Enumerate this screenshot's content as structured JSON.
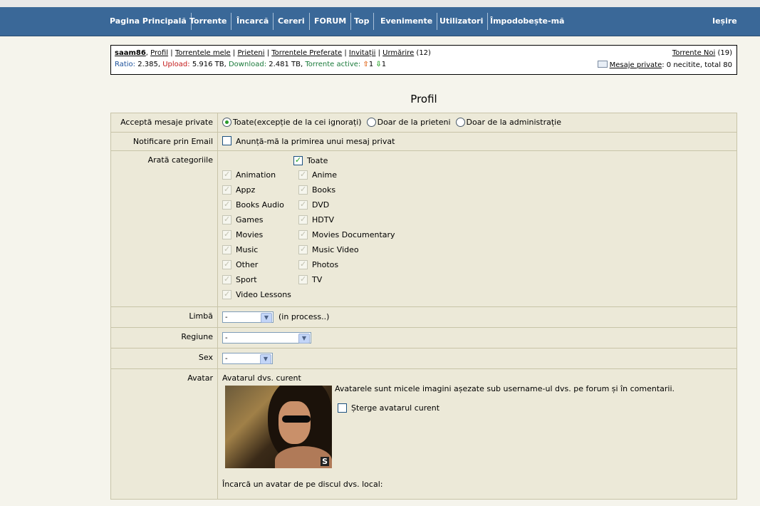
{
  "nav": {
    "items": [
      "Pagina Principală",
      "Torrente",
      "Încarcă",
      "Cereri",
      "FORUM",
      "Top",
      "Evenimente",
      "Utilizatori",
      "Împodobește-mă"
    ],
    "logout": "Ieșire"
  },
  "userbox": {
    "username": "saam86",
    "links": [
      "Profil",
      "Torrentele mele",
      "Prieteni",
      "Torrentele Preferate",
      "Invitații",
      "Urmărire"
    ],
    "follow_count": "(12)",
    "ratio_label": "Ratio:",
    "ratio_value": "2.385",
    "upload_label": "Upload:",
    "upload_value": "5.916 TB",
    "download_label": "Download:",
    "download_value": "2.481 TB",
    "active_label": "Torrente active:",
    "active_up": "1",
    "active_down": "1",
    "new_torrents_label": "Torrente Noi",
    "new_torrents_count": "(19)",
    "pm_label": "Mesaje private",
    "pm_status": ": 0 necitite, total 80"
  },
  "page_title": "Profil",
  "form": {
    "pm_label": "Acceptă mesaje private",
    "pm_options": [
      "Toate(excepție de la cei ignorați)",
      "Doar de la prieteni",
      "Doar de la administrație"
    ],
    "email_label": "Notificare prin Email",
    "email_option": "Anunță-mă la primirea unui mesaj privat",
    "categories_label": "Arată categoriile",
    "categories_all": "Toate",
    "categories": [
      "Animation",
      "Anime",
      "Appz",
      "Books",
      "Books Audio",
      "DVD",
      "Games",
      "HDTV",
      "Movies",
      "Movies Documentary",
      "Music",
      "Music Video",
      "Other",
      "Photos",
      "Sport",
      "TV",
      "Video Lessons"
    ],
    "language_label": "Limbă",
    "language_value": "-",
    "language_note": "(in process..)",
    "region_label": "Regiune",
    "region_value": "-",
    "sex_label": "Sex",
    "sex_value": "-",
    "avatar_label": "Avatar",
    "avatar_current": "Avatarul dvs. curent",
    "avatar_desc": "Avatarele sunt micele imagini așezate sub username-ul dvs. pe forum și în comentarii.",
    "avatar_delete": "Șterge avatarul curent",
    "avatar_badge": "S",
    "avatar_upload": "Încarcă un avatar de pe discul dvs. local:"
  }
}
